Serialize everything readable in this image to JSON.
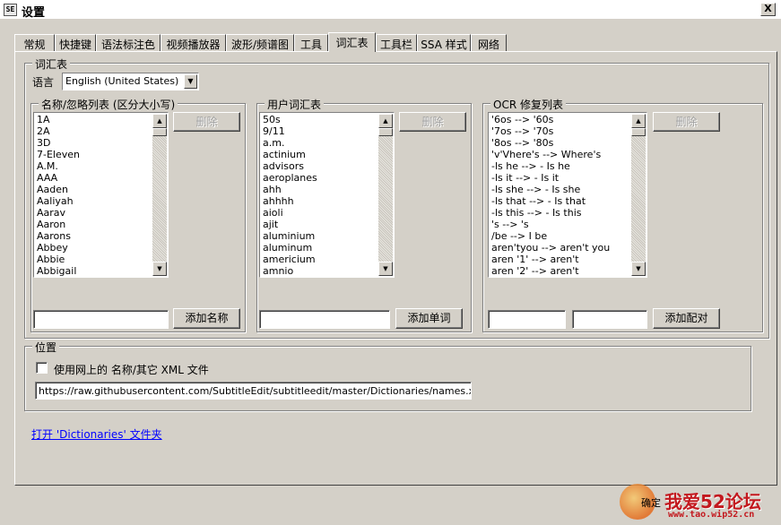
{
  "window": {
    "title": "设置",
    "icon": "subtitle-edit-icon",
    "close_label": "X"
  },
  "tabs": [
    {
      "label": "常规",
      "active": false
    },
    {
      "label": "快捷键",
      "active": false
    },
    {
      "label": "语法标注色",
      "active": false
    },
    {
      "label": "视频播放器",
      "active": false
    },
    {
      "label": "波形/频谱图",
      "active": false
    },
    {
      "label": "工具",
      "active": false
    },
    {
      "label": "词汇表",
      "active": true
    },
    {
      "label": "工具栏",
      "active": false
    },
    {
      "label": "SSA 样式",
      "active": false
    },
    {
      "label": "网络",
      "active": false
    }
  ],
  "wordlists": {
    "group_title": "词汇表",
    "language_label": "语言",
    "language_value": "English (United States)",
    "names": {
      "title": "名称/忽略列表 (区分大小写)",
      "items": [
        "1A",
        "2A",
        "3D",
        "7-Eleven",
        "A.M.",
        "AAA",
        "Aaden",
        "Aaliyah",
        "Aarav",
        "Aaron",
        "Aarons",
        "Abbey",
        "Abbie",
        "Abbigail"
      ],
      "remove_label": "删除",
      "input_value": "",
      "add_label": "添加名称"
    },
    "user": {
      "title": "用户词汇表",
      "items": [
        "50s",
        "9/11",
        "a.m.",
        "actinium",
        "advisors",
        "aeroplanes",
        "ahh",
        "ahhhh",
        "aioli",
        "ajit",
        "aluminium",
        "aluminum",
        "americium",
        "amnio"
      ],
      "remove_label": "删除",
      "input_value": "",
      "add_label": "添加单词"
    },
    "ocr": {
      "title": "OCR 修复列表",
      "items": [
        "'6os --> '60s",
        "'7os --> '70s",
        "'8os --> '80s",
        "'v'Vhere's --> Where's",
        "-ls he --> - Is he",
        "-ls it --> - Is it",
        "-ls she --> - Is she",
        "-ls that --> - Is that",
        "-ls this --> - Is this",
        " 's  --> 's",
        " /be  -->  I be",
        " aren'tyou -->  aren't you",
        " aren '1' -->  aren't",
        " aren '2' -->  aren't"
      ],
      "remove_label": "删除",
      "input_from": "",
      "input_to": "",
      "add_label": "添加配对"
    }
  },
  "location": {
    "group_title": "位置",
    "checkbox_label": "使用网上的 名称/其它 XML 文件",
    "checkbox_checked": false,
    "url_value": "https://raw.githubusercontent.com/SubtitleEdit/subtitleedit/master/Dictionaries/names.xml"
  },
  "open_folder_link": "打开 'Dictionaries' 文件夹",
  "watermark": {
    "text": "我爱52论坛",
    "url": "www.tao.wip52.cn",
    "partial_button": "确定"
  }
}
